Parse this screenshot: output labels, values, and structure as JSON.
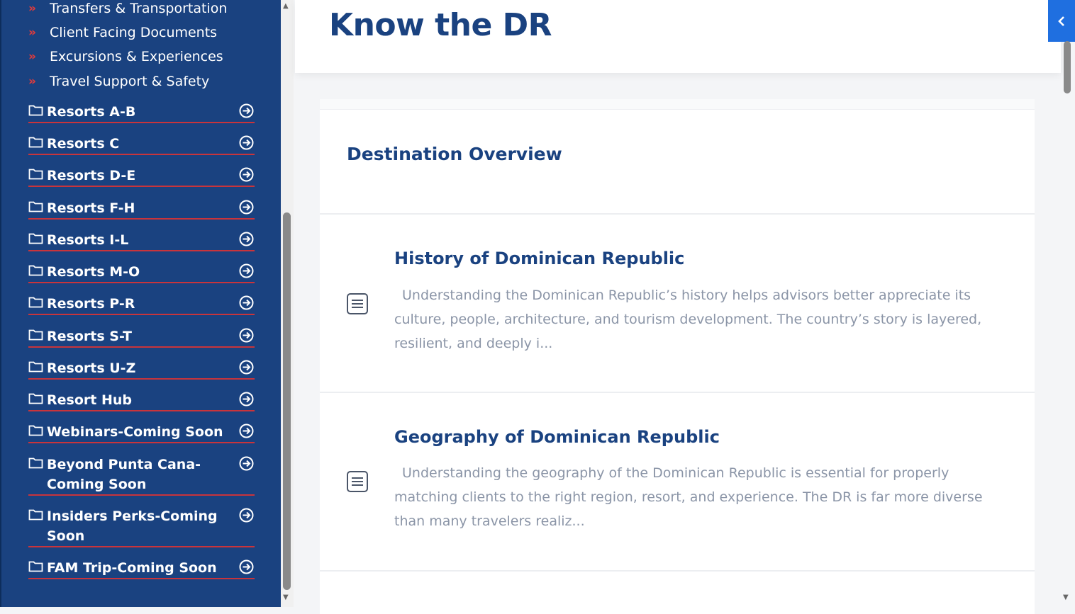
{
  "sidebar": {
    "sub_items": [
      {
        "label": "Transfers & Transportation"
      },
      {
        "label": "Client Facing Documents"
      },
      {
        "label": "Excursions & Experiences"
      },
      {
        "label": "Travel Support & Safety"
      }
    ],
    "folders": [
      {
        "label": "Resorts A-B"
      },
      {
        "label": "Resorts C"
      },
      {
        "label": "Resorts D-E"
      },
      {
        "label": "Resorts F-H"
      },
      {
        "label": "Resorts I-L"
      },
      {
        "label": "Resorts M-O"
      },
      {
        "label": "Resorts P-R"
      },
      {
        "label": "Resorts S-T"
      },
      {
        "label": "Resorts U-Z"
      },
      {
        "label": "Resort Hub"
      },
      {
        "label": "Webinars-Coming Soon"
      },
      {
        "label": "Beyond Punta Cana-Coming Soon",
        "line1": "Beyond Punta Cana-",
        "line2": "Coming Soon"
      },
      {
        "label": "Insiders Perks-Coming Soon",
        "line1": "Insiders Perks-Coming",
        "line2": "Soon"
      },
      {
        "label": "FAM Trip-Coming Soon"
      }
    ]
  },
  "header": {
    "title": "Know the DR"
  },
  "main": {
    "section_title": "Destination Overview",
    "articles": [
      {
        "title": "History of Dominican Republic",
        "excerpt": "Understanding the Dominican Republic’s history helps advisors better appreciate its culture, people, architecture, and tourism development. The country’s story is layered, resilient, and deeply i..."
      },
      {
        "title": "Geography of Dominican Republic",
        "excerpt": "Understanding the geography of the Dominican Republic is essential for properly matching clients to the right region, resort, and experience. The DR is far more diverse than many travelers realiz..."
      }
    ]
  },
  "colors": {
    "sidebar_bg": "#1a4280",
    "accent_red": "#c9343b",
    "title_blue": "#1a4280",
    "excerpt_gray": "#8b95a7",
    "button_blue": "#1f6fe0"
  },
  "icons": {
    "sub_item": "double-chevron-right-icon",
    "folder": "folder-icon",
    "folder_arrow": "circle-arrow-right-icon",
    "article": "document-icon",
    "collapse": "chevron-left-icon"
  }
}
